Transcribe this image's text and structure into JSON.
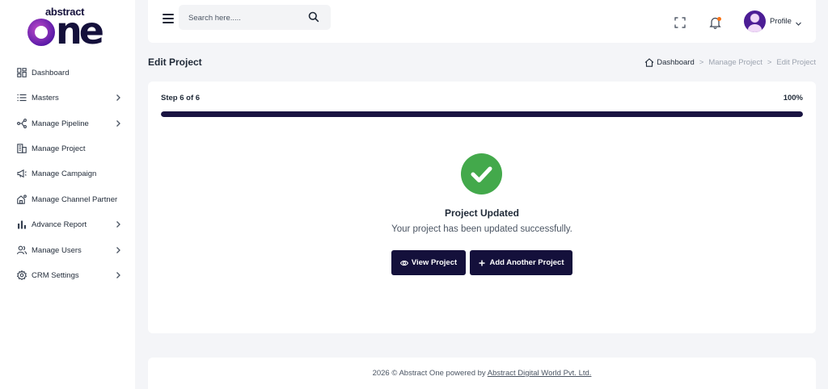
{
  "brand": {
    "logo_small": "abstract",
    "logo_big": "ne"
  },
  "sidebar": {
    "items": [
      {
        "label": "Dashboard",
        "icon": "grid-icon",
        "has_submenu": false
      },
      {
        "label": "Masters",
        "icon": "list-icon",
        "has_submenu": true
      },
      {
        "label": "Manage Pipeline",
        "icon": "pipeline-icon",
        "has_submenu": true
      },
      {
        "label": "Manage Project",
        "icon": "building-icon",
        "has_submenu": false
      },
      {
        "label": "Manage Campaign",
        "icon": "megaphone-icon",
        "has_submenu": false
      },
      {
        "label": "Manage Channel Partner",
        "icon": "partner-icon",
        "has_submenu": false
      },
      {
        "label": "Advance Report",
        "icon": "bar-chart-icon",
        "has_submenu": true
      },
      {
        "label": "Manage Users",
        "icon": "users-icon",
        "has_submenu": true
      },
      {
        "label": "CRM Settings",
        "icon": "gear-icon",
        "has_submenu": true
      }
    ]
  },
  "topbar": {
    "search_placeholder": "Search here.....",
    "profile_label": "Profile"
  },
  "page": {
    "title": "Edit Project",
    "breadcrumb": [
      "Dashboard",
      "Manage Project",
      "Edit Project"
    ],
    "breadcrumb_sep": ">"
  },
  "wizard": {
    "step_label": "Step 6 of 6",
    "progress_percent": 100,
    "progress_label": "100%",
    "success_title": "Project Updated",
    "success_message": "Your project has been updated successfully.",
    "view_button": "View Project",
    "add_button": "Add Another Project"
  },
  "footer": {
    "text": "2026 © Abstract One powered by",
    "link": "Abstract Digital World Pvt. Ltd."
  },
  "colors": {
    "primary": "#14103b",
    "success": "#43a94b",
    "notification": "#f97316"
  }
}
